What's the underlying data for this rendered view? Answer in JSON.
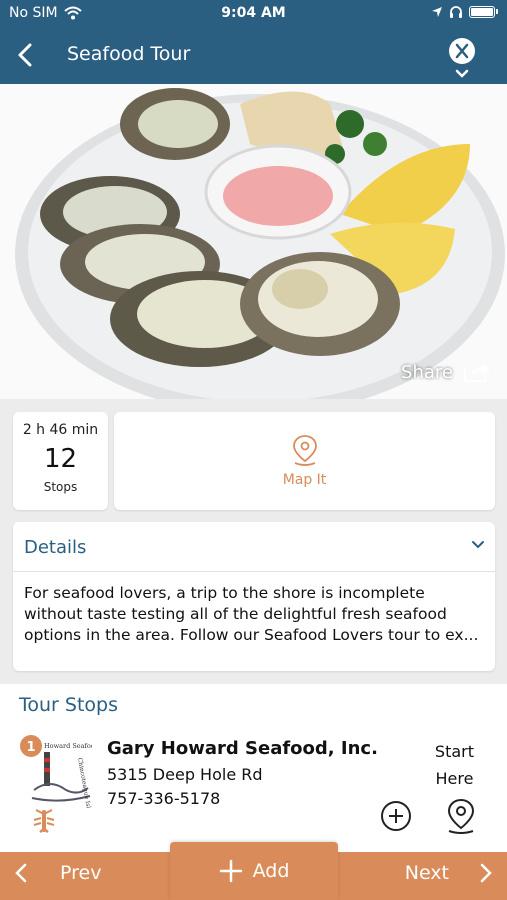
{
  "status": {
    "carrier": "No SIM",
    "time": "9:04 AM"
  },
  "nav": {
    "title": "Seafood Tour"
  },
  "hero": {
    "share_label": "Share"
  },
  "stats": {
    "duration": "2 h 46 min",
    "stops_count": "12",
    "stops_label": "Stops"
  },
  "map": {
    "label": "Map It"
  },
  "details": {
    "title": "Details",
    "text": "For seafood lovers, a trip to the shore is incomplete without taste testing all of the delightful fresh seafood options in the area. Follow our Seafood Lovers tour to ex..."
  },
  "tour_stops": {
    "heading": "Tour Stops",
    "items": [
      {
        "number": "1",
        "name": "Gary Howard Seafood, Inc.",
        "address": "5315 Deep Hole Rd",
        "phone": "757-336-5178",
        "start_line1": "Start",
        "start_line2": "Here",
        "logo_text_top": "Howard Seafood",
        "logo_text_side": "Chincoteague Island"
      }
    ]
  },
  "bottom": {
    "prev_label": "Prev",
    "add_label": "Add",
    "next_label": "Next"
  },
  "colors": {
    "nav_blue": "#2b5f82",
    "accent_orange": "#d98c5a"
  }
}
